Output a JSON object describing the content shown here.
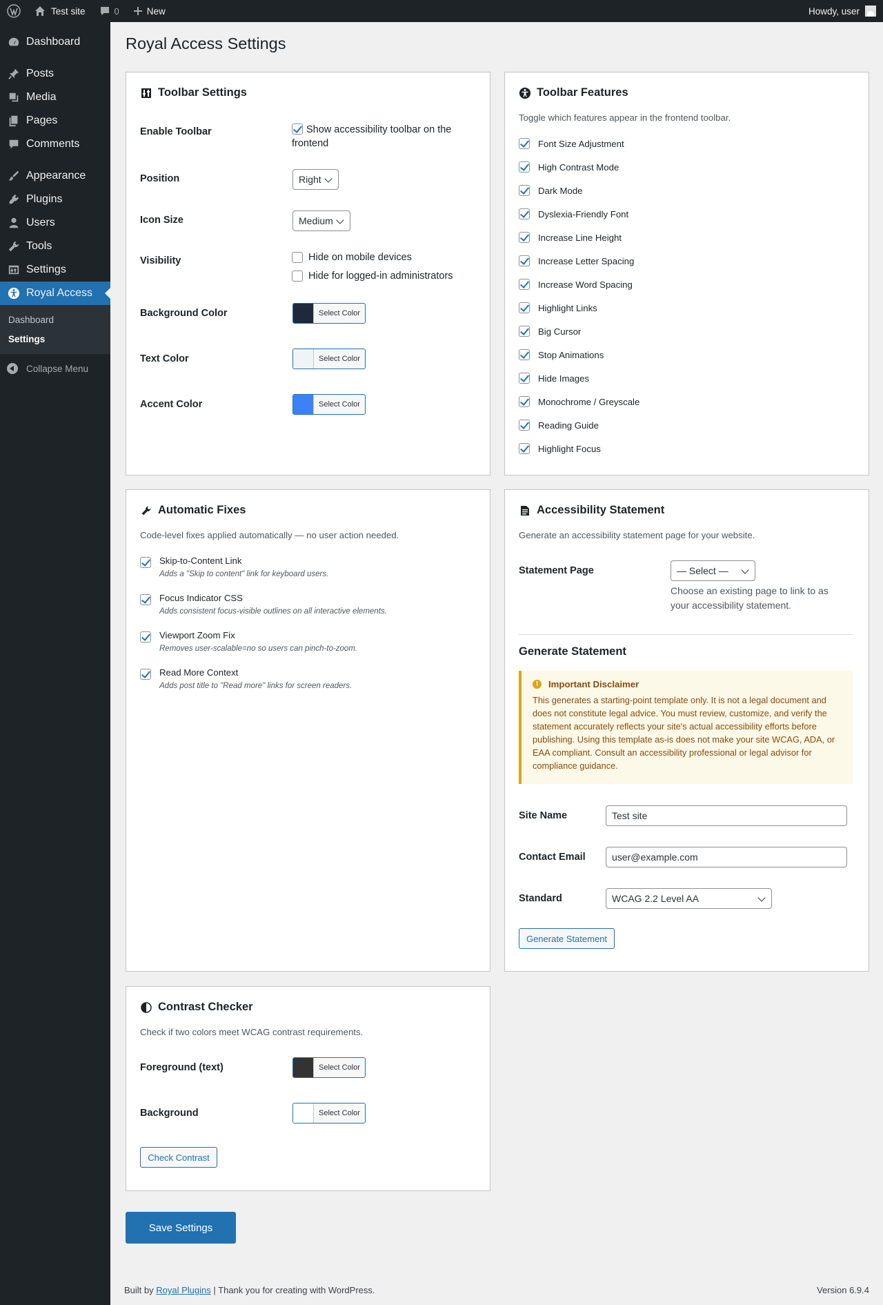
{
  "admin_bar": {
    "site_name": "Test site",
    "comments_count": "0",
    "new_label": "New",
    "greeting": "Howdy, user"
  },
  "sidebar": {
    "items": [
      {
        "label": "Dashboard",
        "icon": "dashboard-icon"
      },
      {
        "label": "Posts",
        "icon": "pin-icon"
      },
      {
        "label": "Media",
        "icon": "media-icon"
      },
      {
        "label": "Pages",
        "icon": "pages-icon"
      },
      {
        "label": "Comments",
        "icon": "comment-icon"
      },
      {
        "label": "Appearance",
        "icon": "brush-icon"
      },
      {
        "label": "Plugins",
        "icon": "plug-icon"
      },
      {
        "label": "Users",
        "icon": "user-icon"
      },
      {
        "label": "Tools",
        "icon": "wrench-icon"
      },
      {
        "label": "Settings",
        "icon": "settings-icon"
      },
      {
        "label": "Royal Access",
        "icon": "accessibility-icon"
      }
    ],
    "submenu": [
      "Dashboard",
      "Settings"
    ],
    "collapse_label": "Collapse Menu"
  },
  "page_title": "Royal Access Settings",
  "toolbar_settings": {
    "title": "Toolbar Settings",
    "enable_label": "Enable Toolbar",
    "enable_text_line1": "Show accessibility toolbar on the",
    "enable_text_line2": "frontend",
    "enable_checked": true,
    "position_label": "Position",
    "position_value": "Right",
    "icon_size_label": "Icon Size",
    "icon_size_value": "Medium",
    "visibility_label": "Visibility",
    "hide_mobile": "Hide on mobile devices",
    "hide_admins": "Hide for logged-in administrators",
    "bg_color_label": "Background Color",
    "text_color_label": "Text Color",
    "accent_color_label": "Accent Color",
    "select_color": "Select Color",
    "bg_color": "#1e293b",
    "text_color": "#f0f4f8",
    "accent_color": "#3b82f6"
  },
  "toolbar_features": {
    "title": "Toolbar Features",
    "description": "Toggle which features appear in the frontend toolbar.",
    "items": [
      "Font Size Adjustment",
      "High Contrast Mode",
      "Dark Mode",
      "Dyslexia-Friendly Font",
      "Increase Line Height",
      "Increase Letter Spacing",
      "Increase Word Spacing",
      "Highlight Links",
      "Big Cursor",
      "Stop Animations",
      "Hide Images",
      "Monochrome / Greyscale",
      "Reading Guide",
      "Highlight Focus"
    ]
  },
  "automatic_fixes": {
    "title": "Automatic Fixes",
    "description": "Code-level fixes applied automatically — no user action needed.",
    "items": [
      {
        "label": "Skip-to-Content Link",
        "desc": "Adds a \"Skip to content\" link for keyboard users."
      },
      {
        "label": "Focus Indicator CSS",
        "desc": "Adds consistent focus-visible outlines on all interactive elements."
      },
      {
        "label": "Viewport Zoom Fix",
        "desc": "Removes user-scalable=no so users can pinch-to-zoom."
      },
      {
        "label": "Read More Context",
        "desc": "Adds post title to \"Read more\" links for screen readers."
      }
    ]
  },
  "statement": {
    "title": "Accessibility Statement",
    "description": "Generate an accessibility statement page for your website.",
    "page_label": "Statement Page",
    "page_value": "— Select —",
    "page_help_line1": "Choose an existing page to link to as",
    "page_help_line2": "your accessibility statement.",
    "generate_heading": "Generate Statement",
    "disclaimer_title": "Important Disclaimer",
    "disclaimer_lines": [
      "This generates a starting-point template only. It is not a legal document and",
      "does not constitute legal advice. You must review, customize, and verify the",
      "statement accurately reflects your site's actual accessibility efforts before",
      "publishing. Using this template as-is does not make your site WCAG, ADA, or",
      "EAA compliant. Consult an accessibility professional or legal advisor for",
      "compliance guidance."
    ],
    "site_name_label": "Site Name",
    "site_name_value": "Test site",
    "email_label": "Contact Email",
    "email_value": "user@example.com",
    "standard_label": "Standard",
    "standard_value": "WCAG 2.2 Level AA",
    "generate_button": "Generate Statement"
  },
  "contrast": {
    "title": "Contrast Checker",
    "description": "Check if two colors meet WCAG contrast requirements.",
    "fg_label": "Foreground (text)",
    "bg_label": "Background",
    "select_color": "Select Color",
    "fg_color": "#333333",
    "bg_color": "#ffffff",
    "check_button": "Check Contrast"
  },
  "save_button": "Save Settings",
  "footer": {
    "built_by": "Built by",
    "link": "Royal Plugins",
    "thanks": "| Thank you for creating with WordPress.",
    "version": "Version 6.9.4"
  }
}
